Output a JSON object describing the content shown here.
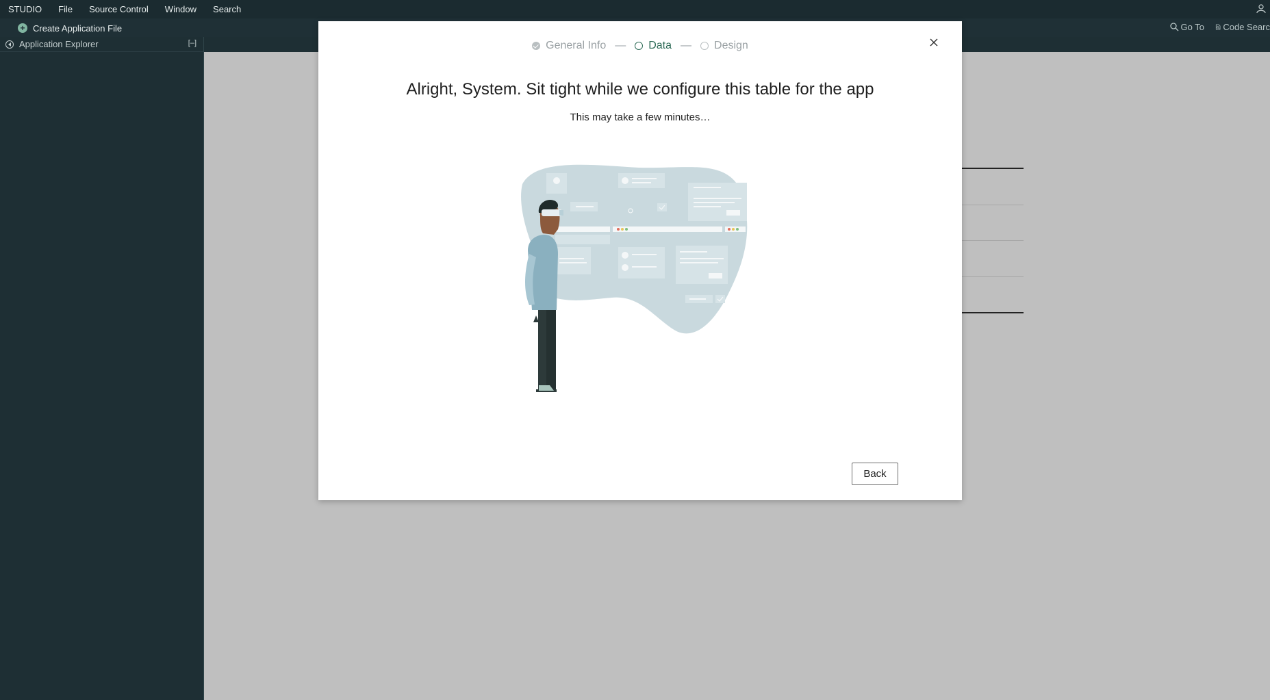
{
  "menubar": {
    "items": [
      "STUDIO",
      "File",
      "Source Control",
      "Window",
      "Search"
    ]
  },
  "toolbar": {
    "create_label": "Create Application File",
    "goto_label": "Go To",
    "code_search_label": "Code Searc"
  },
  "explorer": {
    "title": "Application Explorer",
    "collapse_label": "[–]"
  },
  "modal": {
    "steps": [
      {
        "label": "General Info",
        "state": "done"
      },
      {
        "label": "Data",
        "state": "active"
      },
      {
        "label": "Design",
        "state": "todo"
      }
    ],
    "step_separator": "—",
    "heading": "Alright, System. Sit tight while we configure this table for the app",
    "subheading": "This may take a few minutes…",
    "back_label": "Back"
  },
  "colors": {
    "menubar_bg": "#1b2b30",
    "panel_bg": "#1e2f34",
    "accent_green": "#2e6b57",
    "illustration_blob": "#c9d9de",
    "backdrop": "#bfbfbf"
  }
}
